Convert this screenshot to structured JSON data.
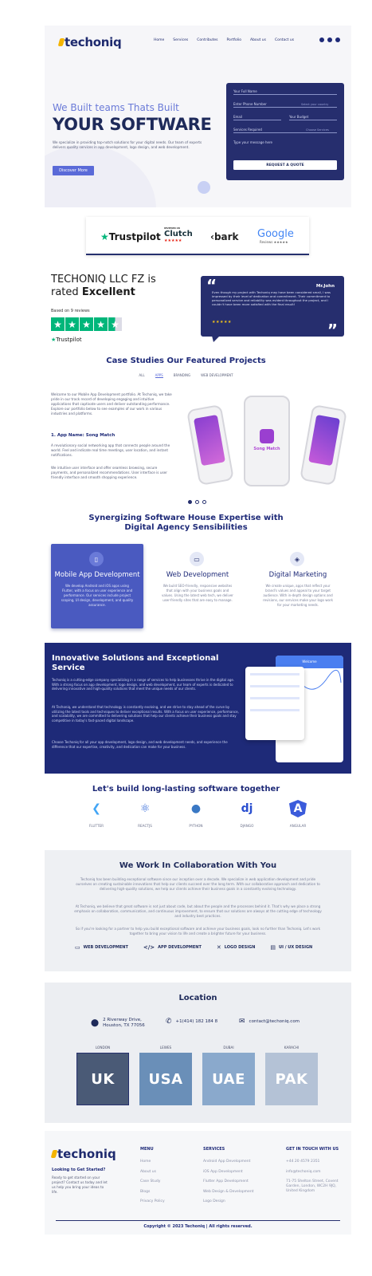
{
  "brand": {
    "name": "techoniq",
    "accent": "#1e2a78",
    "highlight": "#5a6ad8"
  },
  "nav": {
    "items": [
      "Home",
      "Services",
      "Contributes",
      "Portfolio",
      "About us",
      "Contact us"
    ]
  },
  "social": [
    "facebook-icon",
    "instagram-icon",
    "linkedin-icon"
  ],
  "hero": {
    "subtitle": "We Built teams Thats Built",
    "title": "YOUR SOFTWARE",
    "description": "We specialize in providing top-notch solutions for your digital needs. Our team of experts delivers quality services in app development, logo design, and web development.",
    "cta": "Discover More"
  },
  "form": {
    "name": "Your Full Name",
    "phone": "Enter Phone Number",
    "country": "Select your country",
    "email": "Email",
    "budget": "Your Budget",
    "service": "Services Required",
    "service_opt": "Choose Services",
    "message": "Type your message here",
    "submit": "REQUEST A QUOTE"
  },
  "review_logos": {
    "trustpilot": "Trustpilot",
    "clutch": "Clutch",
    "clutch_top": "REVIEWED ON",
    "clutch_stars": "★★★★★",
    "bark": "bark",
    "google": "Google",
    "google_sub": "Reviews ★★★★★"
  },
  "rating": {
    "company": "TECHONIQ LLC FZ is",
    "rated_prefix": "rated",
    "rated": "Excellent",
    "based": "Based on 9 reviews",
    "platform": "Trustpilot",
    "stars": [
      "★",
      "★",
      "★",
      "★",
      "★"
    ]
  },
  "testimonial": {
    "name": "Mr.John",
    "text": "Even though my project with Techoniq may have been considered small, I was impressed by their level of dedication and commitment. Their commitment to personalized service and reliability was evident throughout the project, and I couldn't have been more satisfied with the final result!",
    "stars": "★★★★★"
  },
  "case_studies": {
    "title": "Case Studies Our Featured Projects",
    "tabs": [
      "ALL",
      "APPS",
      "BRANDING",
      "WEB DEVELOPMENT"
    ],
    "intro": "Welcome to our Mobile App Development portfolio. At Techoniq, we take pride in our track record of developing engaging and intuitive applications that captivate users and deliver outstanding performance. Explore our portfolio below to see examples of our work in various industries and platforms.",
    "app_name": "1. App Name: Song Match",
    "p1": "A revolutionary social networking app that connects people around the world. Feel and indicate real time meetings, user location, and instant notifications.",
    "p2": "We intuitive user interface and offer seamless browsing, secure payments, and personalized recommendations. User interface is user friendly interface and smooth shopping experience.",
    "app_logo": "Song Match"
  },
  "expertise": {
    "title_line1": "Synergizing Software House Expertise with",
    "title_line2": "Digital Agency Sensibilities",
    "services": [
      {
        "name": "Mobile App Development",
        "icon": "mobile-icon",
        "desc": "We develop Android and iOS apps using Flutter, with a focus on user experience and performance. Our services include project scoping, UI design, development, and quality assurance."
      },
      {
        "name": "Web Development",
        "icon": "monitor-icon",
        "desc": "We build SEO-friendly, responsive websites that align with your business goals and values. Using the latest web tech, we deliver user-friendly sites that are easy to manage."
      },
      {
        "name": "Digital Marketing",
        "icon": "layers-icon",
        "desc": "We create unique, apps that reflect your brand's values and appeal to your target audience. With in-depth design options and revisions, our services make your logo work for your marketing needs."
      }
    ]
  },
  "innovative": {
    "title": "Innovative Solutions and Exceptional Service",
    "p1": "Techoniq is a cutting-edge company specializing in a range of services to help businesses thrive in the digital age. With a strong focus on app development, logo design, and web development, our team of experts is dedicated to delivering innovative and high-quality solutions that meet the unique needs of our clients.",
    "p2": "At Techoniq, we understand that technology is constantly evolving, and we strive to stay ahead of the curve by utilizing the latest tools and techniques to deliver exceptional results. With a focus on user experience, performance, and scalability, we are committed to delivering solutions that help our clients achieve their business goals and stay competitive in today's fast-paced digital landscape.",
    "p3": "Choose Techoniq for all your app development, logo design, and web development needs, and experience the difference that our expertise, creativity, and dedication can make for your business.",
    "dash_title": "Welcome"
  },
  "tech": {
    "title": "Let's build long-lasting software together",
    "items": [
      {
        "label": "FLUTTER",
        "glyph": "❮",
        "color": "#42a5f5"
      },
      {
        "label": "REACTJS",
        "glyph": "⚛",
        "color": "#2a63d8"
      },
      {
        "label": "PYTHON",
        "glyph": "●",
        "color": "#3a78c4"
      },
      {
        "label": "DJANGO",
        "glyph": "dj",
        "color": "#2a4fd0"
      },
      {
        "label": "ANGULAR",
        "glyph": "A",
        "color": "#3b5bdb"
      }
    ]
  },
  "collab": {
    "title": "We Work In Collaboration With You",
    "p1": "Techoniq has been building exceptional software since our inception over a decade. We specialize in web application development and pride ourselves on creating sustainable innovations that help our clients succeed over the long term. With our collaborative approach and dedication to delivering high-quality solutions, we help our clients achieve their business goals in a constantly evolving technology.",
    "p2": "At Techoniq, we believe that great software is not just about code, but about the people and the processes behind it. That's why we place a strong emphasis on collaboration, communication, and continuous improvement, to ensure that our solutions are always at the cutting edge of technology and industry best practices.",
    "p3": "So if you're looking for a partner to help you build exceptional software and achieve your business goals, look no further than Techoniq. Let's work together to bring your vision to life and create a brighter future for your business.",
    "links": [
      {
        "label": "WEB DEVELOPMENT",
        "icon": "monitor-icon",
        "glyph": "▭"
      },
      {
        "label": "APP DEVELOPMENT",
        "icon": "code-icon",
        "glyph": "</>"
      },
      {
        "label": "LOGO DESIGN",
        "icon": "design-icon",
        "glyph": "✕"
      },
      {
        "label": "UI / UX DESIGN",
        "icon": "layout-icon",
        "glyph": "▤"
      }
    ]
  },
  "location": {
    "title": "Location",
    "address": "2 Riverway Drive, Houston, TX 77056",
    "phone": "+1(414) 182 184 8",
    "email": "contact@techoniq.com",
    "cities": [
      {
        "name": "LONDON",
        "code": "UK",
        "color": "#4a5a76"
      },
      {
        "name": "LEWES",
        "code": "USA",
        "color": "#6a8fb8"
      },
      {
        "name": "DUBAI",
        "code": "UAE",
        "color": "#8aa9cc"
      },
      {
        "name": "KARACHI",
        "code": "PAK",
        "color": "#b4c2d6"
      }
    ]
  },
  "footer": {
    "tagline": "Looking to Get Started?",
    "about": "Ready to get started on your project? Contact us today and let us help you bring your ideas to life.",
    "menu_title": "MENU",
    "menu": [
      "Home",
      "About us",
      "Case Study",
      "Blogs",
      "Privacy Policy"
    ],
    "services_title": "SERVICES",
    "services": [
      "Android App Development",
      "iOS App Development",
      "Flutter App Development",
      "Web Design & Development",
      "Logo Design"
    ],
    "contact_title": "GET IN TOUCH WITH US",
    "phone": "+44 20 4579 2351",
    "email": "info@techoniq.com",
    "address": "71-75 Shelton Street, Covent Garden, London, WC2H 9JQ, United Kingdom",
    "copyright": "Copyright © 2023 Techoniq | All rights reserved."
  }
}
